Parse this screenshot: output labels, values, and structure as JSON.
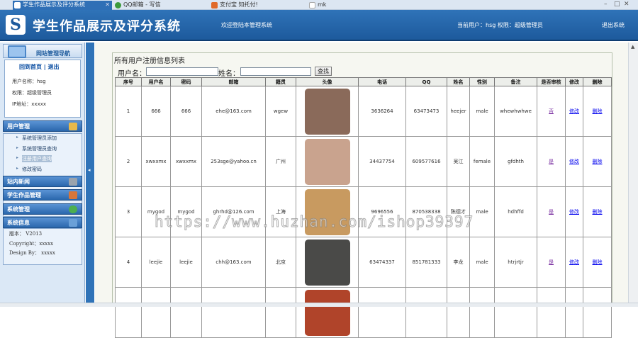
{
  "browser": {
    "tabs": [
      {
        "label": "学生作品展示及评分系统",
        "active": true
      },
      {
        "label": "QQ邮箱 - 写信",
        "active": false
      },
      {
        "label": "支付宝 知托付!",
        "active": false
      },
      {
        "label": "mk",
        "active": false
      }
    ]
  },
  "header": {
    "logo_letter": "S",
    "title": "学生作品展示及评分系统",
    "welcome": "欢迎登陆本管理系统",
    "user_info": "当前用户：hsg 权限：超级管理员",
    "logout": "退出系统"
  },
  "sidebar": {
    "nav_title": "网站管理导航",
    "home_link": "回到首页",
    "sep": "|",
    "exit_link": "退出",
    "username_line": "用户名称：hsg",
    "role_line": "权限：超级管理员",
    "ip_line": "IP地址：xxxxx",
    "sections": {
      "user_mgmt": "用户管理",
      "site_news": "站内新闻",
      "works_mgmt": "学生作品管理",
      "system_mgmt": "系统管理",
      "system_info": "系统信息"
    },
    "user_menu": [
      {
        "label": "系统管理员添加",
        "selected": false
      },
      {
        "label": "系统管理员查询",
        "selected": false
      },
      {
        "label": "注册用户查询",
        "selected": true
      },
      {
        "label": "修改密码",
        "selected": false
      }
    ],
    "version_line": "版本： V2013",
    "copyright_line": "Copyright：xxxxx",
    "design_line": "Design By： xxxxx"
  },
  "main": {
    "title": "所有用户注册信息列表",
    "search": {
      "username_label": "用户名：",
      "name_label": "姓名：",
      "button": "查找"
    },
    "columns": [
      "序号",
      "用户名",
      "密码",
      "邮箱",
      "籍贯",
      "头像",
      "电话",
      "QQ",
      "姓名",
      "性别",
      "备注",
      "是否审核",
      "修改",
      "删除"
    ],
    "rows": [
      {
        "no": "1",
        "username": "666",
        "password": "666",
        "email": "ehe@163.com",
        "origin": "wgew",
        "avatar_color": "#8a6a5a",
        "phone": "3636264",
        "qq": "63473473",
        "name": "heejer",
        "gender": "male",
        "note": "whewhwhwe",
        "audit": "否",
        "edit": "修改",
        "delete": "删除"
      },
      {
        "no": "2",
        "username": "xwxxmx",
        "password": "xwxxmx",
        "email": "253sge@yahoo.cn",
        "origin": "广州",
        "avatar_color": "#c9a38e",
        "phone": "34437754",
        "qq": "609577616",
        "name": "吴江",
        "gender": "female",
        "note": "gfdhth",
        "audit": "是",
        "edit": "修改",
        "delete": "删除"
      },
      {
        "no": "3",
        "username": "mygod",
        "password": "mygod",
        "email": "ghrhd@126.com",
        "origin": "上海",
        "avatar_color": "#c89a60",
        "phone": "9696556",
        "qq": "870538338",
        "name": "陈德才",
        "gender": "male",
        "note": "hdhffd",
        "audit": "是",
        "edit": "修改",
        "delete": "删除"
      },
      {
        "no": "4",
        "username": "leejie",
        "password": "leejie",
        "email": "chh@163.com",
        "origin": "北京",
        "avatar_color": "#4a4a48",
        "phone": "63474337",
        "qq": "851781333",
        "name": "李龙",
        "gender": "male",
        "note": "htrjrtjr",
        "audit": "是",
        "edit": "修改",
        "delete": "删除"
      },
      {
        "no": "",
        "username": "",
        "password": "",
        "email": "",
        "origin": "",
        "avatar_color": "#b0442a",
        "phone": "",
        "qq": "",
        "name": "",
        "gender": "",
        "note": "",
        "audit": "",
        "edit": "",
        "delete": ""
      }
    ]
  },
  "watermark": "https://www.huzhan.com/ishop39397"
}
